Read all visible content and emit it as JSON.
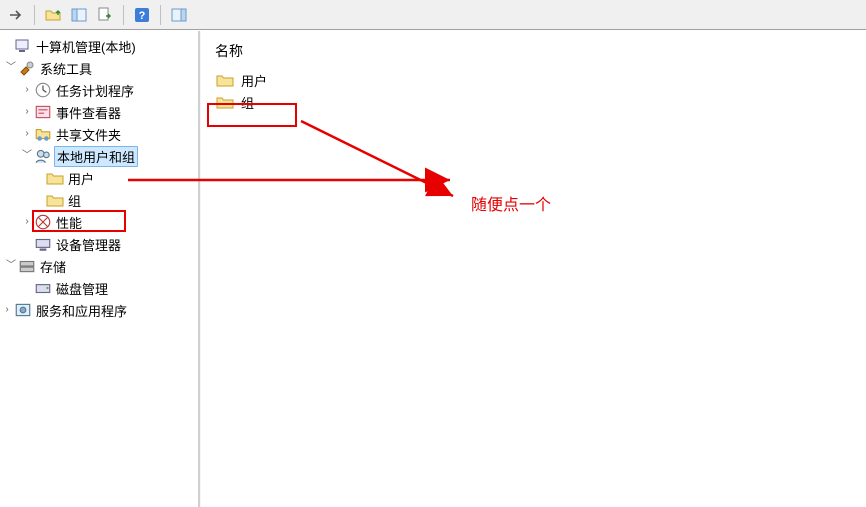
{
  "toolbar": {
    "buttons": [
      "back-arrow",
      "folder-up",
      "view-panel",
      "export",
      "help",
      "view-split"
    ]
  },
  "tree": {
    "root_label": "十算机管理(本地)",
    "system_tools": {
      "label": "系统工具",
      "children": {
        "task_scheduler": "任务计划程序",
        "event_viewer": "事件查看器",
        "shared_folders": "共享文件夹",
        "local_users_groups": {
          "label": "本地用户和组",
          "children": {
            "users": "用户",
            "groups": "组"
          }
        },
        "performance": "性能",
        "device_manager": "设备管理器"
      }
    },
    "storage": {
      "label": "存储",
      "children": {
        "disk_mgmt": "磁盘管理"
      }
    },
    "services_apps": "服务和应用程序"
  },
  "content": {
    "column_header": "名称",
    "items": {
      "users": "用户",
      "groups": "组"
    }
  },
  "annotation": {
    "text": "随便点一个"
  },
  "colors": {
    "highlight": "#e60000",
    "selection_bg": "#cde8ff",
    "selection_border": "#7ab6e8"
  }
}
